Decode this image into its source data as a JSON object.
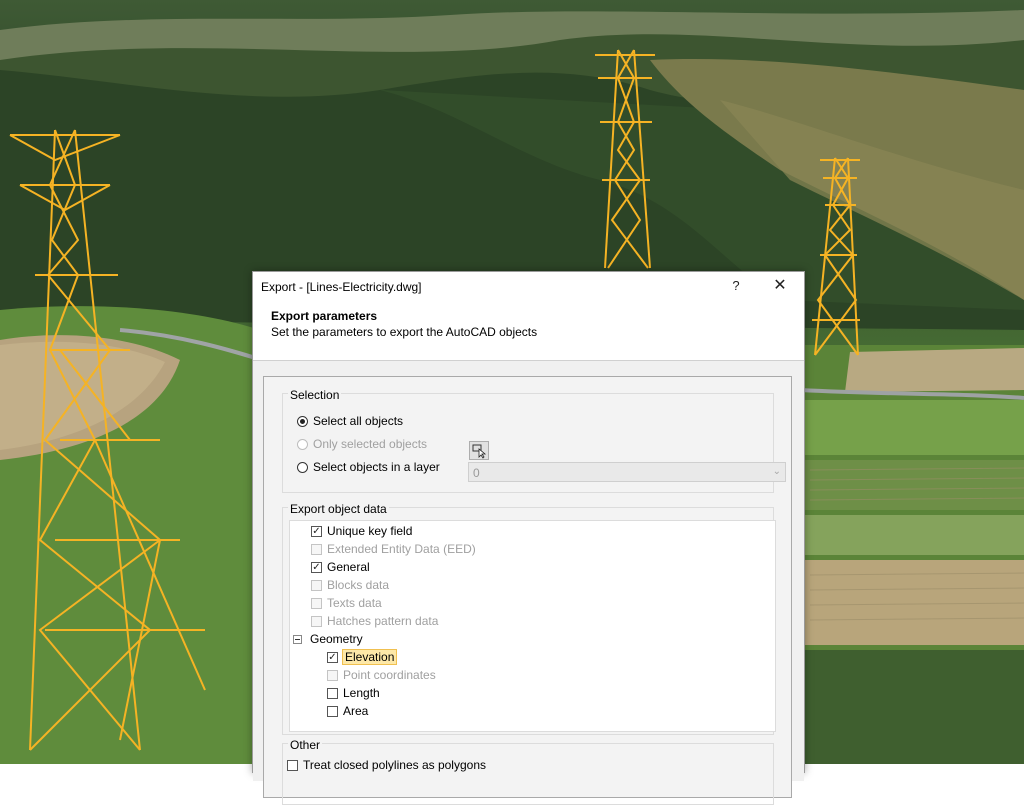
{
  "dialog": {
    "title": "Export - [Lines-Electricity.dwg]",
    "help_label": "?",
    "close_label": "✕",
    "header_title": "Export parameters",
    "header_subtitle": "Set the parameters to export the AutoCAD objects"
  },
  "selection": {
    "group_label": "Selection",
    "select_all_label": "Select all objects",
    "only_selected_label": "Only selected objects",
    "layer_label": "Select objects in a layer",
    "layer_value": "0",
    "selected": "select_all"
  },
  "export_object_data": {
    "group_label": "Export object data",
    "items": [
      {
        "label": "Unique key field",
        "checked": true,
        "enabled": true
      },
      {
        "label": "Extended Entity Data (EED)",
        "checked": false,
        "enabled": false
      },
      {
        "label": "General",
        "checked": true,
        "enabled": true
      },
      {
        "label": "Blocks data",
        "checked": false,
        "enabled": false
      },
      {
        "label": "Texts data",
        "checked": false,
        "enabled": false
      },
      {
        "label": "Hatches pattern data",
        "checked": false,
        "enabled": false
      }
    ],
    "geometry": {
      "label": "Geometry",
      "children": [
        {
          "label": "Elevation",
          "checked": true,
          "enabled": true,
          "highlighted": true
        },
        {
          "label": "Point coordinates",
          "checked": false,
          "enabled": false
        },
        {
          "label": "Length",
          "checked": false,
          "enabled": true
        },
        {
          "label": "Area",
          "checked": false,
          "enabled": true
        }
      ]
    }
  },
  "other": {
    "group_label": "Other",
    "treat_closed_label": "Treat closed polylines as polygons",
    "treat_closed_checked": false
  },
  "colors": {
    "tower": "#f5b324",
    "highlight": "#fde8a8"
  }
}
